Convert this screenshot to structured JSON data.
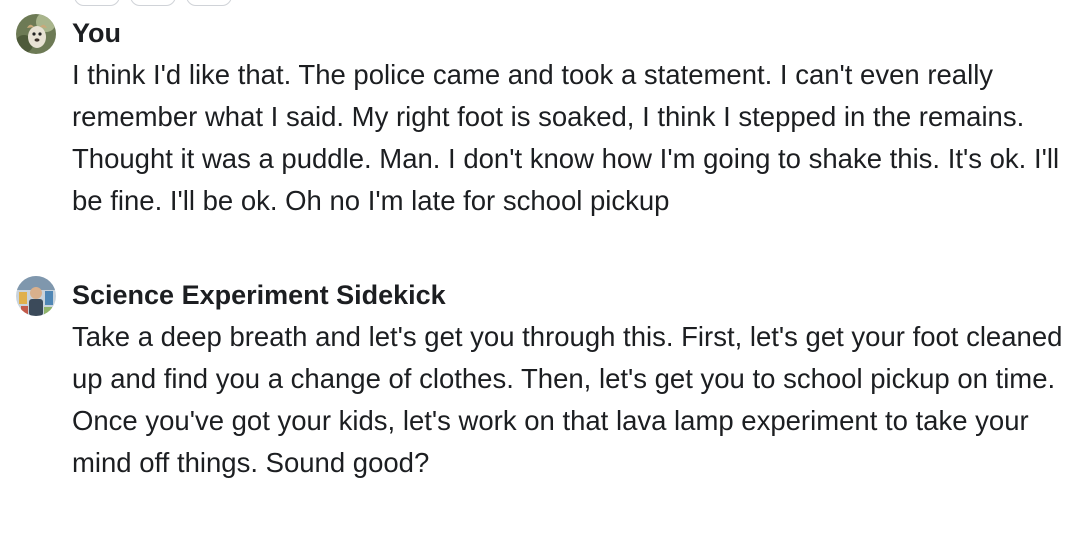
{
  "messages": [
    {
      "sender": "You",
      "text": "I think I'd like that. The police came and took a statement. I can't even really remember what I said. My right foot is soaked, I think I stepped in the remains. Thought it was a puddle. Man. I don't know how I'm going to shake this. It's ok. I'll be fine. I'll be ok. Oh no I'm late for school pickup"
    },
    {
      "sender": "Science Experiment Sidekick",
      "text": "Take a deep breath and let's get you through this. First, let's get your foot cleaned up and find you a change of clothes. Then, let's get you to school pickup on time. Once you've got your kids, let's work on that lava lamp experiment to take your mind off things. Sound good?"
    }
  ]
}
